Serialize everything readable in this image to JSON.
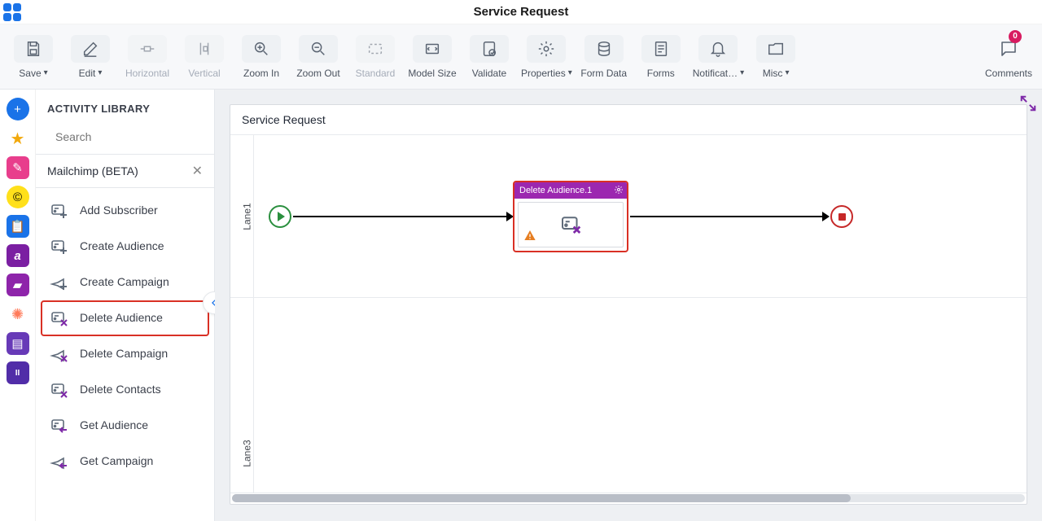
{
  "header": {
    "page_title": "Service Request"
  },
  "toolbar": [
    {
      "id": "save",
      "label": "Save",
      "dropdown": true
    },
    {
      "id": "edit",
      "label": "Edit",
      "dropdown": true
    },
    {
      "id": "horizontal",
      "label": "Horizontal",
      "disabled": true
    },
    {
      "id": "vertical",
      "label": "Vertical",
      "disabled": true
    },
    {
      "id": "zoom-in",
      "label": "Zoom In"
    },
    {
      "id": "zoom-out",
      "label": "Zoom Out"
    },
    {
      "id": "standard",
      "label": "Standard",
      "disabled": true
    },
    {
      "id": "model-size",
      "label": "Model Size"
    },
    {
      "id": "validate",
      "label": "Validate"
    },
    {
      "id": "properties",
      "label": "Properties",
      "dropdown": true
    },
    {
      "id": "form-data",
      "label": "Form Data"
    },
    {
      "id": "forms",
      "label": "Forms"
    },
    {
      "id": "notifications",
      "label": "Notificat…",
      "dropdown": true
    },
    {
      "id": "misc",
      "label": "Misc",
      "dropdown": true
    }
  ],
  "comments": {
    "label": "Comments",
    "count": 0
  },
  "panel": {
    "title": "ACTIVITY LIBRARY",
    "search_placeholder": "Search",
    "group": "Mailchimp (BETA)",
    "items": [
      {
        "label": "Add Subscriber"
      },
      {
        "label": "Create Audience"
      },
      {
        "label": "Create Campaign"
      },
      {
        "label": "Delete Audience",
        "selected": true
      },
      {
        "label": "Delete Campaign"
      },
      {
        "label": "Delete Contacts"
      },
      {
        "label": "Get Audience"
      },
      {
        "label": "Get Campaign"
      }
    ]
  },
  "canvas": {
    "title": "Service Request",
    "lanes": [
      "Lane1",
      "Lane3"
    ],
    "activity_node": {
      "title": "Delete Audience.1",
      "has_warning": true
    }
  }
}
